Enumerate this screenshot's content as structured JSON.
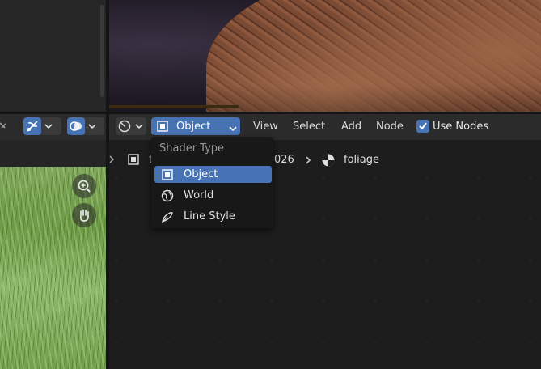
{
  "node_editor_header": {
    "shader_type_selected": "Object",
    "menus": [
      "View",
      "Select",
      "Add",
      "Node"
    ],
    "use_nodes_label": "Use Nodes",
    "use_nodes_checked": true
  },
  "shader_type_menu": {
    "title": "Shader Type",
    "options": [
      {
        "label": "Object",
        "icon": "object-icon",
        "selected": true
      },
      {
        "label": "World",
        "icon": "world-icon",
        "selected": false
      },
      {
        "label": "Line Style",
        "icon": "line-style-icon",
        "selected": false
      }
    ]
  },
  "breadcrumb": {
    "object_fragment": "t",
    "material_fragment": "026",
    "material_name": "foliage"
  },
  "colors": {
    "accent": "#4772b3",
    "header_bg": "#2b2b2b",
    "editor_bg": "#1d1d1d",
    "menu_bg": "#181818"
  }
}
